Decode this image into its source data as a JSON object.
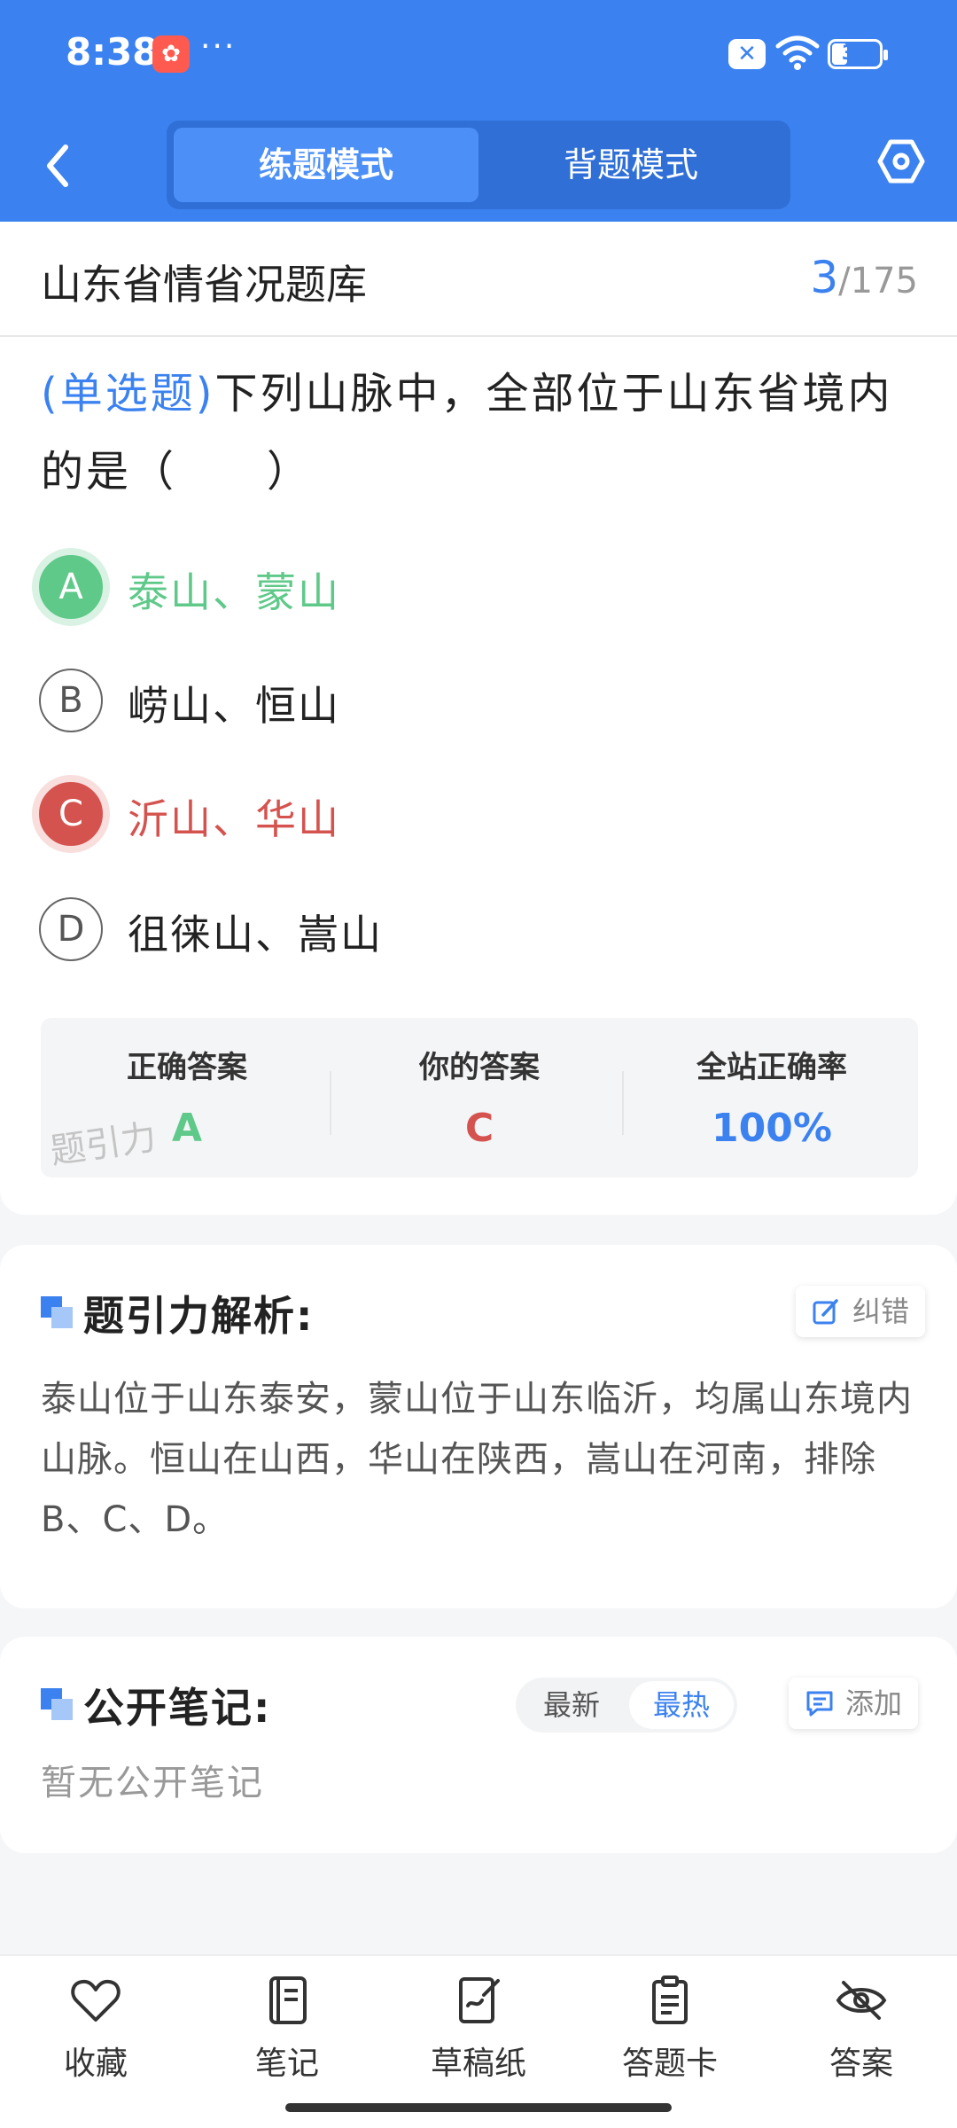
{
  "status_bar": {
    "time": "8:38",
    "more": "···",
    "battery": "31"
  },
  "header": {
    "tabs": [
      {
        "label": "练题模式",
        "active": true
      },
      {
        "label": "背题模式",
        "active": false
      }
    ]
  },
  "bank": {
    "title": "山东省情省况题库",
    "current": "3",
    "total": "/175"
  },
  "question": {
    "type": "(单选题)",
    "text": "下列山脉中，全部位于山东省境内的是（　　）"
  },
  "options": [
    {
      "letter": "A",
      "text": "泰山、蒙山",
      "state": "correct"
    },
    {
      "letter": "B",
      "text": "崂山、恒山",
      "state": "normal"
    },
    {
      "letter": "C",
      "text": "沂山、华山",
      "state": "wrong"
    },
    {
      "letter": "D",
      "text": "徂徕山、嵩山",
      "state": "normal"
    }
  ],
  "result": {
    "correct_label": "正确答案",
    "correct_value": "A",
    "yours_label": "你的答案",
    "yours_value": "C",
    "rate_label": "全站正确率",
    "rate_value": "100%",
    "watermark": "题引力"
  },
  "analysis": {
    "title": "题引力解析:",
    "report_label": "纠错",
    "text": "泰山位于山东泰安，蒙山位于山东临沂，均属山东境内山脉。恒山在山西，华山在陕西，嵩山在河南，排除B、C、D。"
  },
  "notes": {
    "title": "公开笔记:",
    "sort_new": "最新",
    "sort_hot": "最热",
    "add_label": "添加",
    "empty": "暂无公开笔记"
  },
  "bottom_nav": [
    {
      "label": "收藏",
      "icon": "heart-icon"
    },
    {
      "label": "笔记",
      "icon": "notebook-icon"
    },
    {
      "label": "草稿纸",
      "icon": "draft-icon"
    },
    {
      "label": "答题卡",
      "icon": "clipboard-icon"
    },
    {
      "label": "答案",
      "icon": "eye-off-icon"
    }
  ],
  "colors": {
    "primary": "#3b82f0",
    "correct": "#5fc98a",
    "wrong": "#d5534f"
  }
}
